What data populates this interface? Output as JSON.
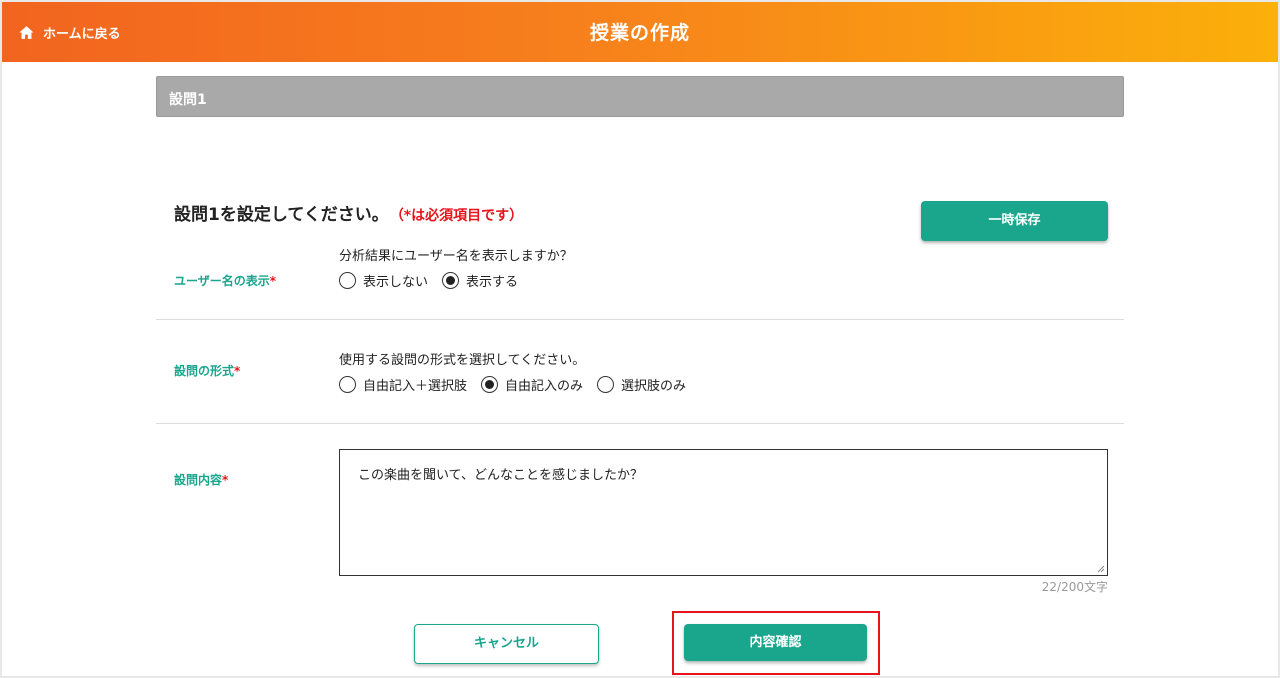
{
  "header": {
    "home_label": "ホームに戻る",
    "title": "授業の作成"
  },
  "section": {
    "title": "設問1"
  },
  "instruction": {
    "text": "設問1を設定してください。",
    "required_note": "（*は必須項目です）"
  },
  "save_button": "一時保存",
  "username_field": {
    "label": "ユーザー名の表示",
    "asterisk": "*",
    "question": "分析結果にユーザー名を表示しますか？",
    "options": [
      "表示しない",
      "表示する"
    ],
    "selected": "表示する"
  },
  "format_field": {
    "label": "設問の形式",
    "asterisk": "*",
    "question": "使用する設問の形式を選択してください。",
    "options": [
      "自由記入＋選択肢",
      "自由記入のみ",
      "選択肢のみ"
    ],
    "selected": "自由記入のみ"
  },
  "content_field": {
    "label": "設問内容",
    "asterisk": "*",
    "value": "この楽曲を聞いて、どんなことを感じましたか？",
    "counter": "22/200文字"
  },
  "buttons": {
    "cancel": "キャンセル",
    "confirm": "内容確認"
  },
  "colors": {
    "header_start": "#f2641f",
    "header_end": "#fbb00a",
    "accent": "#1aa58d",
    "required": "#e8141c",
    "highlight": "#e8141c"
  }
}
